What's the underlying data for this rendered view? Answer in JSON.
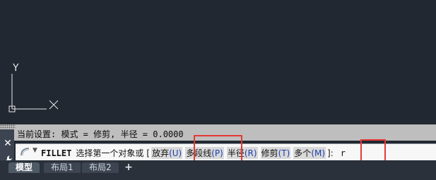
{
  "viewport": {
    "axis_label_y": "Y"
  },
  "command_line": {
    "history": "当前设置: 模式 = 修剪, 半径 = 0.0000",
    "prompt": {
      "command": "FILLET",
      "text_before": "选择第一个对象或",
      "bracket_open": "[",
      "options": [
        {
          "label": "放弃",
          "key": "(U)"
        },
        {
          "label": "多段线",
          "key": "(P)"
        },
        {
          "label": "半径",
          "key": "(R)"
        },
        {
          "label": "修剪",
          "key": "(T)"
        },
        {
          "label": "多个",
          "key": "(M)"
        }
      ],
      "bracket_close": "]:",
      "user_input": "r"
    },
    "close_icon": "close-icon",
    "wrench_icon": "wrench-icon"
  },
  "layout_tabs": {
    "tabs": [
      {
        "label": "模型",
        "active": true
      },
      {
        "label": "布局1",
        "active": false
      },
      {
        "label": "布局2",
        "active": false
      }
    ],
    "add_label": "+"
  },
  "colors": {
    "canvas": "#222831",
    "highlight": "#e53935",
    "option_key": "#1a3fb0"
  }
}
